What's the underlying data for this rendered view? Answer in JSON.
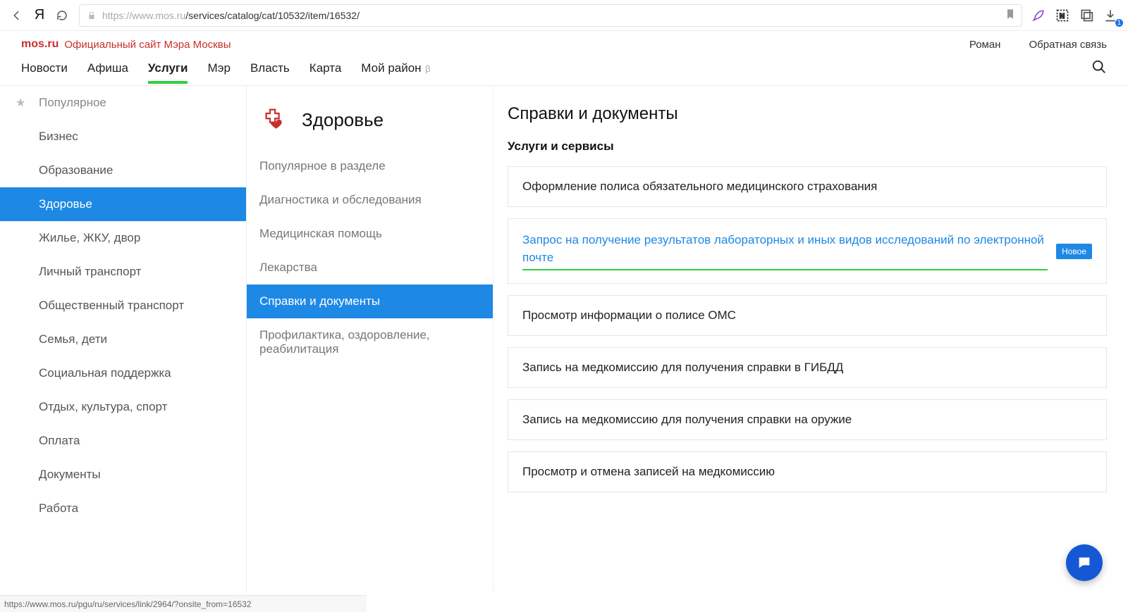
{
  "chrome": {
    "url_domain": "https://www.mos.ru",
    "url_path": "/services/catalog/cat/10532/item/16532/",
    "download_badge": "1"
  },
  "header": {
    "brand": "mos.ru",
    "brand_sub": "Официальный сайт Мэра Москвы",
    "user": "Роман",
    "feedback": "Обратная связь"
  },
  "nav": {
    "items": [
      "Новости",
      "Афиша",
      "Услуги",
      "Мэр",
      "Власть",
      "Карта",
      "Мой район"
    ],
    "beta_suffix": "β",
    "active_index": 2
  },
  "sidebar": {
    "items": [
      "Популярное",
      "Бизнес",
      "Образование",
      "Здоровье",
      "Жилье, ЖКУ, двор",
      "Личный транспорт",
      "Общественный транспорт",
      "Семья, дети",
      "Социальная поддержка",
      "Отдых, культура, спорт",
      "Оплата",
      "Документы",
      "Работа"
    ],
    "selected_index": 3
  },
  "subcat": {
    "title": "Здоровье",
    "items": [
      "Популярное в разделе",
      "Диагностика и обследования",
      "Медицинская помощь",
      "Лекарства",
      "Справки и документы",
      "Профилактика, оздоровление, реабилитация"
    ],
    "selected_index": 4
  },
  "content": {
    "heading": "Справки и документы",
    "subtitle": "Услуги и сервисы",
    "tag_new": "Новое",
    "services": [
      {
        "title": "Оформление полиса обязательного медицинского страхования",
        "highlight": false,
        "new": false
      },
      {
        "title": "Запрос на получение результатов лабораторных и иных видов исследований по электронной почте",
        "highlight": true,
        "new": true
      },
      {
        "title": "Просмотр информации о полисе ОМС",
        "highlight": false,
        "new": false
      },
      {
        "title": "Запись на медкомиссию для получения справки в ГИБДД",
        "highlight": false,
        "new": false
      },
      {
        "title": "Запись на медкомиссию для получения справки на оружие",
        "highlight": false,
        "new": false
      },
      {
        "title": "Просмотр и отмена записей на медкомиссию",
        "highlight": false,
        "new": false
      }
    ]
  },
  "status_bar": "https://www.mos.ru/pgu/ru/services/link/2964/?onsite_from=16532"
}
